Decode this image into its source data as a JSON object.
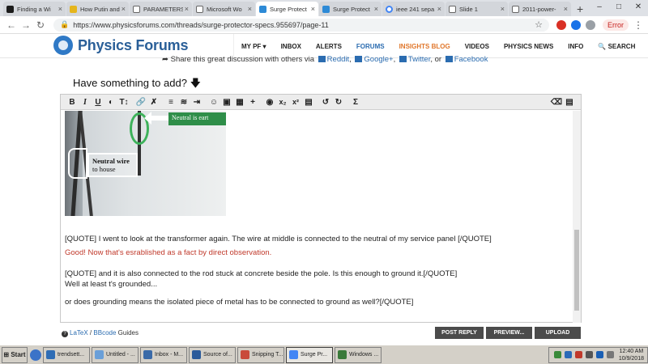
{
  "browser": {
    "tabs": [
      {
        "title": "Finding a Wi",
        "icon": "lbc-icon"
      },
      {
        "title": "How Putin and",
        "icon": "yellow-icon"
      },
      {
        "title": "PARAMETERS",
        "icon": "doc-icon"
      },
      {
        "title": "Microsoft Wo",
        "icon": "doc-icon"
      },
      {
        "title": "Surge Protect",
        "icon": "pf-icon",
        "active": true
      },
      {
        "title": "Surge Protect",
        "icon": "pf-icon"
      },
      {
        "title": "ieee 241 sepa",
        "icon": "google-icon"
      },
      {
        "title": "Slide 1",
        "icon": "doc-icon"
      },
      {
        "title": "2011-power-",
        "icon": "doc-icon"
      }
    ],
    "url": "https://www.physicsforums.com/threads/surge-protector-specs.955697/page-11",
    "error_label": "Error"
  },
  "site": {
    "logo_text": "Physics Forums",
    "nav": [
      "MY PF",
      "INBOX",
      "ALERTS",
      "FORUMS",
      "INSIGHTS BLOG",
      "VIDEOS",
      "PHYSICS NEWS",
      "INFO",
      "SEARCH"
    ],
    "nav_colors": {
      "forums": "#2b6cb0",
      "blog": "#e0762a"
    }
  },
  "share": {
    "prefix": "Share this great discussion with others via",
    "reddit": "Reddit",
    "google": "Google+",
    "twitter": "Twitter",
    "or": ", or",
    "facebook": "Facebook"
  },
  "reply": {
    "title": "Have something to add?",
    "image_labels": {
      "green": "Neutral is eart",
      "box_line1": "Neutral wire",
      "box_line2": "to house"
    },
    "lines": [
      "[QUOTE] I went to look at the transformer again. The wire at middle is connected to the neutral of my service panel [/QUOTE]",
      "Good!  Now that's esrablished as a fact by direct observation.",
      "[QUOTE] and it is also connected to the rod stuck at concrete beside the pole. Is this enough to ground it.[/QUOTE]",
      "Well at least t's grounded...",
      "or does grounding means the isolated piece of metal has to be connected to ground as well?[/QUOTE]"
    ],
    "guides_latex": "LaTeX",
    "guides_sep": "/",
    "guides_bbcode": "BBcode",
    "guides_suffix": "Guides",
    "buttons": {
      "post": "POST REPLY",
      "preview": "PREVIEW...",
      "upload": "UPLOAD"
    }
  },
  "taskbar": {
    "start": "Start",
    "items": [
      {
        "label": "trendsett...",
        "icon": "#2f6db5"
      },
      {
        "label": "Untitled - ...",
        "icon": "#6a9fd8"
      },
      {
        "label": "Inbox - M...",
        "icon": "#3a6aa8"
      },
      {
        "label": "Source of...",
        "icon": "#2a5a9a"
      },
      {
        "label": "Snipping T...",
        "icon": "#c94a3a"
      },
      {
        "label": "Surge Pr...",
        "icon": "#4285f4",
        "active": true
      },
      {
        "label": "Windows ...",
        "icon": "#3a7a3a"
      }
    ],
    "time": "12:40 AM",
    "date": "10/9/2018"
  }
}
